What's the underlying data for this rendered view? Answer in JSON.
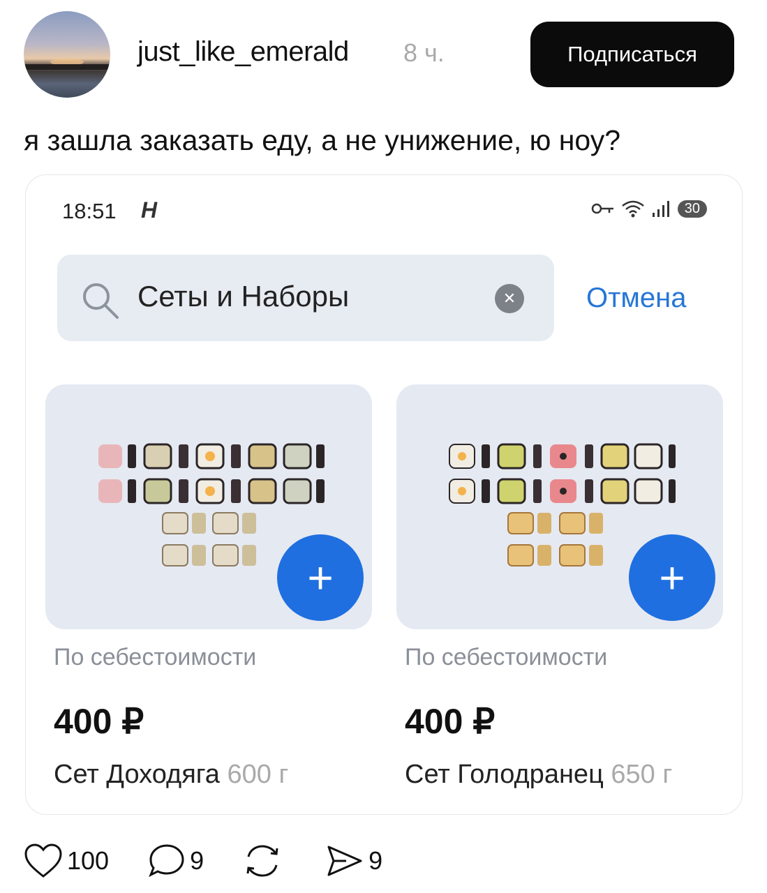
{
  "post": {
    "username": "just_like_emerald",
    "time": "8 ч.",
    "subscribe_label": "Подписаться",
    "text": "я зашла заказать еду, а не унижение, ю ноу?"
  },
  "screenshot": {
    "status_time": "18:51",
    "status_h": "H",
    "battery": "30",
    "search_value": "Сеты и Наборы",
    "cancel_label": "Отмена",
    "products": [
      {
        "subtitle": "По себестоимости",
        "price": "400 ₽",
        "name": "Сет Доходяга",
        "weight": "600 г",
        "add_label": "+"
      },
      {
        "subtitle": "По себестоимости",
        "price": "400 ₽",
        "name": "Сет Голодранец",
        "weight": "650 г",
        "add_label": "+"
      }
    ]
  },
  "actions": {
    "likes": "100",
    "comments": "9",
    "shares": "9"
  },
  "colors": {
    "accent_blue": "#1f6fe0",
    "cancel_blue": "#2676d6",
    "card_bg": "#e5e9f2"
  }
}
